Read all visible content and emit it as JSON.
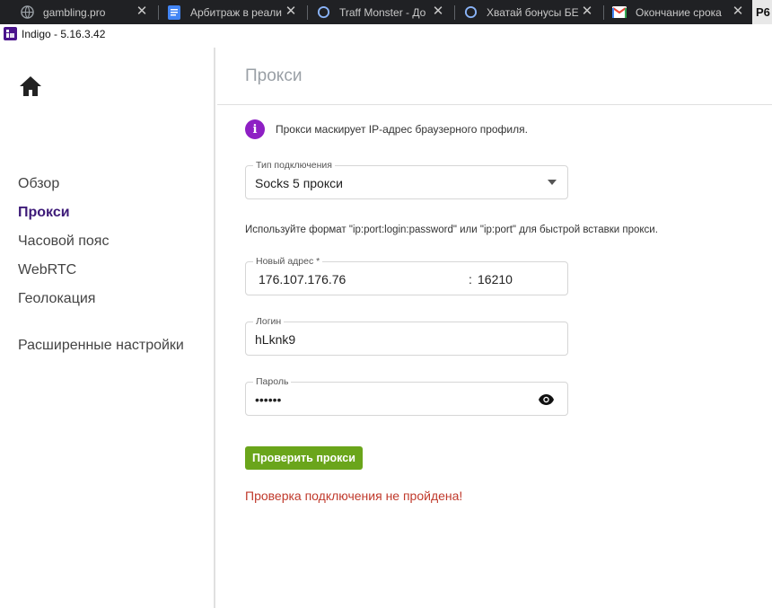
{
  "browser_tabs": [
    {
      "title": "gambling.pro",
      "icon": "globe-icon"
    },
    {
      "title": "Арбитраж в реали",
      "icon": "docs-icon"
    },
    {
      "title": "Traff Monster - До",
      "icon": "loading-ring-icon"
    },
    {
      "title": "Хватай бонусы БЕ",
      "icon": "loading-ring-icon"
    },
    {
      "title": "Окончание срока",
      "icon": "gmail-icon"
    }
  ],
  "tab_edge_label": "P6",
  "tab_close_glyph": "✕",
  "app": {
    "title": "Indigo - 5.16.3.42",
    "icon": "indigo-app-icon"
  },
  "sidebar": {
    "home_icon": "home-icon",
    "items": [
      {
        "label": "Обзор",
        "active": false
      },
      {
        "label": "Прокси",
        "active": true
      },
      {
        "label": "Часовой пояс",
        "active": false
      },
      {
        "label": "WebRTC",
        "active": false
      },
      {
        "label": "Геолокация",
        "active": false
      },
      {
        "label": "Расширенные настройки",
        "active": false
      }
    ]
  },
  "main": {
    "title": "Прокси",
    "info": {
      "icon_glyph": "i",
      "text": "Прокси маскирует IP-адрес браузерного профиля."
    },
    "connection_type": {
      "label": "Тип подключения",
      "value": "Socks 5 прокси"
    },
    "hint": "Используйте формат \"ip:port:login:password\" или \"ip:port\" для быстрой вставки прокси.",
    "address": {
      "label": "Новый адрес *",
      "ip": "176.107.176.76",
      "separator": ":",
      "port": "16210"
    },
    "login": {
      "label": "Логин",
      "value": "hLknk9"
    },
    "password": {
      "label": "Пароль",
      "value": "••••••",
      "toggle_icon": "eye-icon"
    },
    "check_button": "Проверить прокси",
    "error": "Проверка подключения не пройдена!"
  },
  "colors": {
    "accent_purple": "#3d1a78",
    "info_icon": "#8e1fc4",
    "button_green": "#6aa51b",
    "error_red": "#c0392b"
  }
}
